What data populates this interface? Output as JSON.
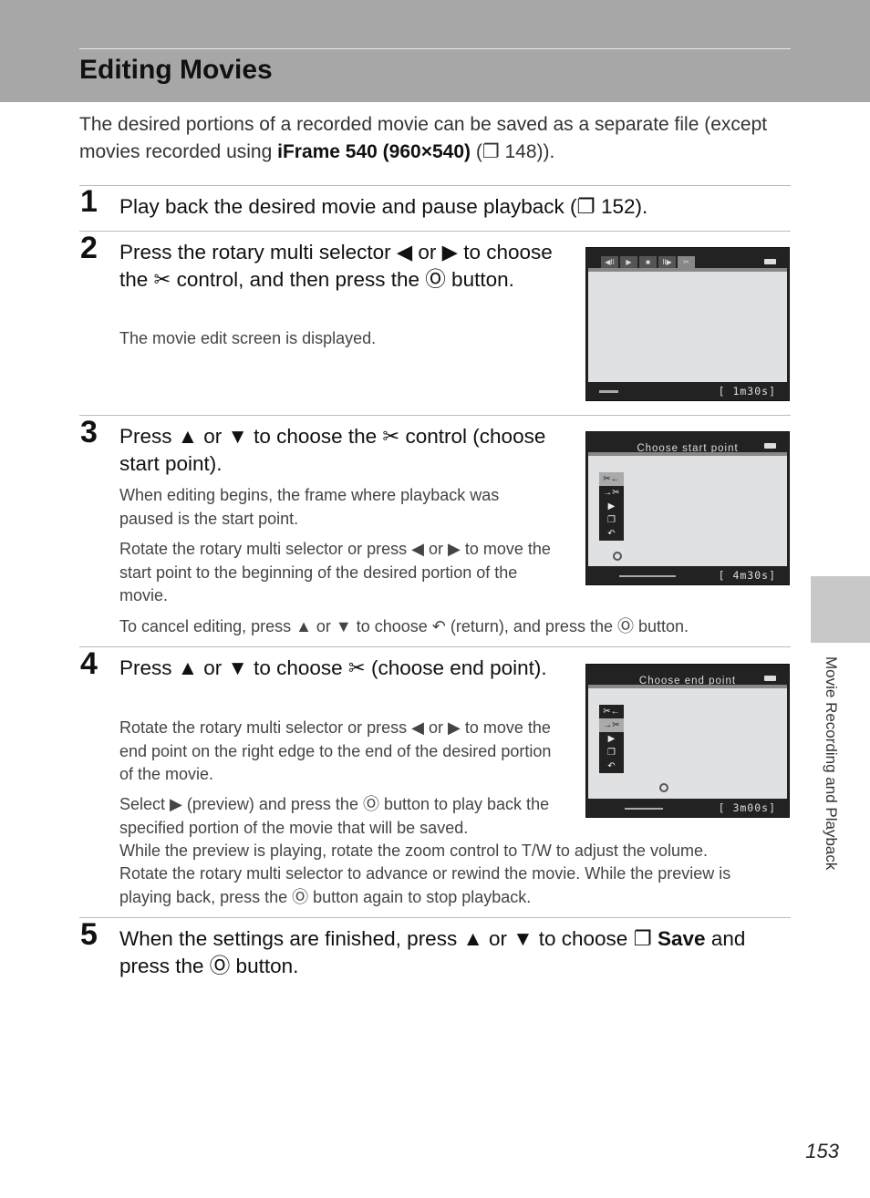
{
  "header": {
    "title": "Editing Movies"
  },
  "intro": {
    "text_before": "The desired portions of a recorded movie can be saved as a separate file (except movies recorded using ",
    "icon": "iframe-icon",
    "bold": "iFrame 540 (960×540)",
    "text_after": " (❐ 148))."
  },
  "steps": [
    {
      "number": "1",
      "heading": "Play back the desired movie and pause playback (❐ 152)."
    },
    {
      "number": "2",
      "heading": "Press the rotary multi selector ◀ or ▶ to choose the ✂ control, and then press the Ⓞ button.",
      "body": [
        "The movie edit screen is displayed."
      ],
      "screen": {
        "time": "[  1m30s]",
        "controls": [
          "◀II",
          "▶",
          "■",
          "II▶",
          "✂"
        ]
      }
    },
    {
      "number": "3",
      "heading": "Press ▲ or ▼ to choose the ✂ control (choose start point).",
      "body": [
        "When editing begins, the frame where playback was paused is the start point.",
        "Rotate the rotary multi selector or press ◀ or ▶ to move the start point to the beginning of the desired portion of the movie.",
        "To cancel editing, press ▲ or ▼ to choose ↶ (return), and press the Ⓞ button."
      ],
      "screen": {
        "title": "Choose start point",
        "time": "[  4m30s]"
      }
    },
    {
      "number": "4",
      "heading": "Press ▲ or ▼ to choose ✂ (choose end point).",
      "body": [
        "Rotate the rotary multi selector or press ◀ or ▶ to move the end point on the right edge to the end of the desired portion of the movie.",
        "Select ▶ (preview) and press the Ⓞ button to play back the specified portion of the movie that will be saved.",
        "While the preview is playing, rotate the zoom control to T/W to adjust the volume.",
        "Rotate the rotary multi selector to advance or rewind the movie. While the preview is playing back, press the Ⓞ button again to stop playback."
      ],
      "screen": {
        "title": "Choose end point",
        "time": "[  3m00s]"
      }
    },
    {
      "number": "5",
      "heading_before": "When the settings are finished, press ▲ or ▼ to choose ❐ ",
      "heading_bold": "Save",
      "heading_after": " and press the Ⓞ button."
    }
  ],
  "menu_icons": [
    "✂←",
    "→✂",
    "▶",
    "❐",
    "↶"
  ],
  "side_tab": "Movie Recording and Playback",
  "page_number": "153"
}
